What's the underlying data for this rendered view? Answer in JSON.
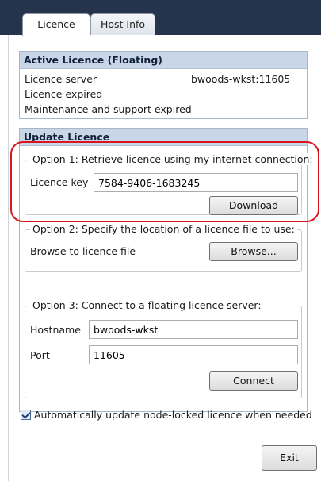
{
  "tabs": [
    {
      "label": "Licence",
      "active": true
    },
    {
      "label": "Host Info",
      "active": false
    }
  ],
  "active_licence": {
    "header": "Active Licence (Floating)",
    "server_label": "Licence server",
    "server_value": "bwoods-wkst:11605",
    "status": "Licence expired",
    "maintenance": "Maintenance and support expired"
  },
  "update_licence": {
    "header": "Update Licence",
    "option1": {
      "legend": "Option 1: Retrieve licence using my internet connection:",
      "key_label": "Licence key",
      "key_value": "7584-9406-1683245",
      "button": "Download"
    },
    "option2": {
      "legend": "Option 2: Specify the location of a licence file to use:",
      "label": "Browse to licence file",
      "button": "Browse..."
    },
    "option3": {
      "legend": "Option 3: Connect to a floating licence server:",
      "hostname_label": "Hostname",
      "hostname_value": "bwoods-wkst",
      "port_label": "Port",
      "port_value": "11605",
      "button": "Connect"
    }
  },
  "auto_update": {
    "label": "Automatically update node-locked licence when needed",
    "checked": true
  },
  "exit_button": "Exit",
  "colors": {
    "tabstrip": "#25344c",
    "section_header": "#c8d6e8",
    "highlight": "#d9161d"
  }
}
